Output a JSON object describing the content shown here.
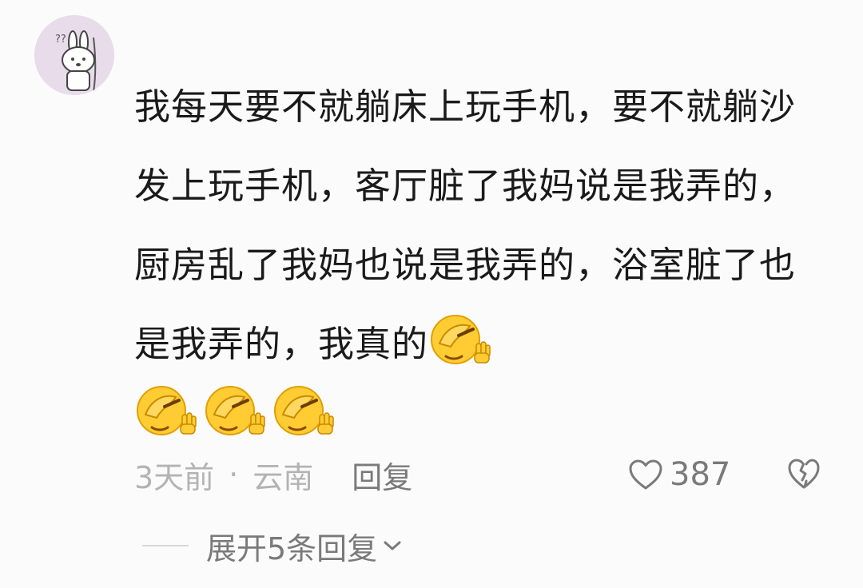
{
  "comment": {
    "avatar_icon": "bunny-avatar-icon",
    "avatar_doodle": "??",
    "text": "我每天要不就躺床上玩手机，要不就躺沙发上玩手机，客厅脏了我妈说是我弄的，厨房乱了我妈也说是我弄的，浴室脏了也是我弄的，我真的",
    "emoji_icon": "facepalm-emoji-icon",
    "emoji_count": 4,
    "time": "3天前",
    "separator": "·",
    "location": "云南",
    "reply_label": "回复",
    "like_count": "387",
    "expand_label": "展开5条回复"
  },
  "colors": {
    "text": "#1a1a1a",
    "meta": "#b3b3b3",
    "action": "#7a7a7a",
    "avatar_bg": "#e8dcea",
    "emoji_yellow": "#ffcc33"
  }
}
